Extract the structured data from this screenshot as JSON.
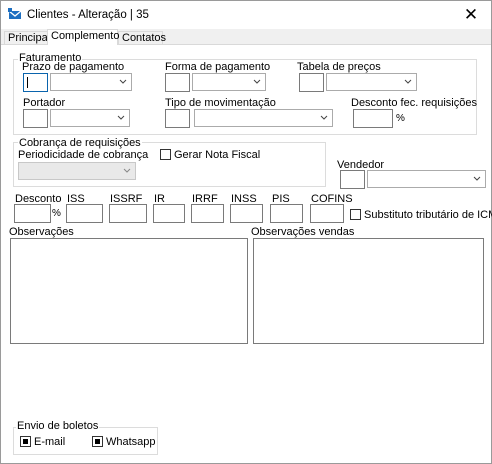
{
  "window": {
    "title": "Clientes - Alteração | 35",
    "close_glyph": "✕",
    "icon": "app-icon"
  },
  "tabs": [
    {
      "label": "Principal",
      "active": false
    },
    {
      "label": "Complemento",
      "active": true
    },
    {
      "label": "Contatos",
      "active": false
    }
  ],
  "faturamento": {
    "group_label": "Faturamento",
    "prazo_label": "Prazo de pagamento",
    "forma_label": "Forma de pagamento",
    "tabela_label": "Tabela de preços",
    "portador_label": "Portador",
    "tipo_mov_label": "Tipo de movimentação",
    "desconto_fec_label": "Desconto fec. requisições",
    "percent": "%"
  },
  "cobranca": {
    "group_label": "Cobrança de requisições",
    "periodicidade_label": "Periodicidade de cobrança",
    "gerar_nf_label": "Gerar Nota Fiscal",
    "gerar_nf_checked": false
  },
  "vendedor": {
    "label": "Vendedor"
  },
  "impostos": {
    "desconto": "Desconto",
    "percent": "%",
    "iss": "ISS",
    "issrf": "ISSRF",
    "ir": "IR",
    "irrf": "IRRF",
    "inss": "INSS",
    "pis": "PIS",
    "cofins": "COFINS",
    "substituto_label": "Substituto tributário de ICMS",
    "substituto_checked": false
  },
  "observacoes": {
    "label": "Observações",
    "vendas_label": "Observações vendas"
  },
  "boletos": {
    "group_label": "Envio de boletos",
    "email_label": "E-mail",
    "email_checked": true,
    "whatsapp_label": "Whatsapp",
    "whatsapp_checked": true
  }
}
